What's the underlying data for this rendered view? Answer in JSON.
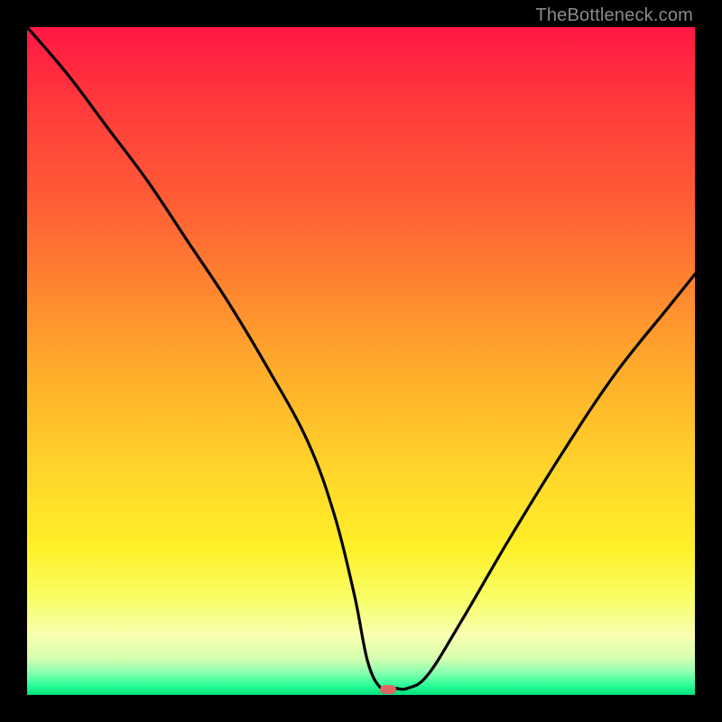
{
  "watermark": "TheBottleneck.com",
  "colors": {
    "background": "#000000",
    "curve_stroke": "#000000",
    "marker_fill": "#e06666",
    "gradient_stops": [
      {
        "offset": 0.0,
        "color": "#ff1744"
      },
      {
        "offset": 0.12,
        "color": "#ff3b3b"
      },
      {
        "offset": 0.25,
        "color": "#ff5a36"
      },
      {
        "offset": 0.38,
        "color": "#ff8230"
      },
      {
        "offset": 0.52,
        "color": "#ffae2b"
      },
      {
        "offset": 0.66,
        "color": "#ffd42a"
      },
      {
        "offset": 0.78,
        "color": "#fff029"
      },
      {
        "offset": 0.86,
        "color": "#f8ff6a"
      },
      {
        "offset": 0.91,
        "color": "#faffb0"
      },
      {
        "offset": 0.945,
        "color": "#d6ffb0"
      },
      {
        "offset": 0.965,
        "color": "#8fffb0"
      },
      {
        "offset": 0.985,
        "color": "#2fff9a"
      },
      {
        "offset": 1.0,
        "color": "#00e07a"
      }
    ]
  },
  "chart_data": {
    "type": "line",
    "title": "",
    "xlabel": "",
    "ylabel": "",
    "xlim": [
      0,
      100
    ],
    "ylim": [
      0,
      100
    ],
    "grid": false,
    "legend": false,
    "series": [
      {
        "name": "bottleneck-curve",
        "x": [
          0,
          6,
          12,
          18,
          24,
          30,
          36,
          42,
          46,
          49,
          51,
          53,
          55,
          57,
          60,
          65,
          72,
          80,
          88,
          96,
          100
        ],
        "y": [
          100,
          93,
          85,
          77,
          68,
          59,
          49,
          38,
          27,
          15,
          5,
          1,
          1,
          1,
          3,
          11,
          23,
          36,
          48,
          58,
          63
        ]
      }
    ],
    "marker": {
      "x": 54,
      "y": 0.8
    }
  }
}
